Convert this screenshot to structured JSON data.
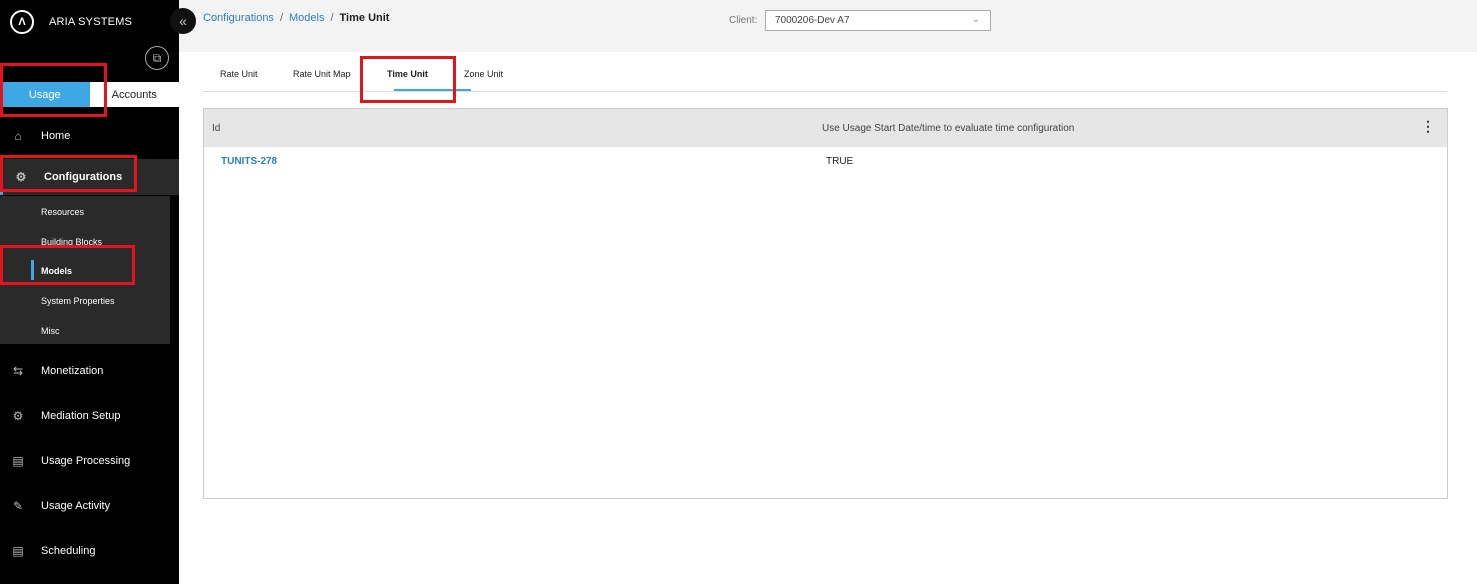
{
  "sidebar": {
    "brand_logo": "Λ",
    "brand_name": "ARIA SYSTEMS",
    "collapse_icon": "«",
    "popout_icon": "⧉",
    "module_tabs": [
      {
        "label": "Usage",
        "active": true
      },
      {
        "label": "Accounts",
        "active": false
      }
    ],
    "items": [
      {
        "label": "Home",
        "icon": "⌂"
      },
      {
        "label": "Configurations",
        "icon": "⚙"
      },
      {
        "label": "Monetization",
        "icon": "⇆"
      },
      {
        "label": "Mediation Setup",
        "icon": "⚙"
      },
      {
        "label": "Usage Processing",
        "icon": "▤"
      },
      {
        "label": "Usage Activity",
        "icon": "✎"
      },
      {
        "label": "Scheduling",
        "icon": "▤"
      }
    ],
    "sub_items": [
      "Resources",
      "Building Blocks",
      "Models",
      "System Properties",
      "Misc"
    ]
  },
  "breadcrumb": {
    "items": [
      "Configurations",
      "Models"
    ],
    "separator": "/",
    "current": "Time Unit"
  },
  "client": {
    "label": "Client:",
    "value": "7000206-Dev A7",
    "chevron": "⌄"
  },
  "tabs": [
    "Rate Unit",
    "Rate Unit Map",
    "Time Unit",
    "Zone Unit"
  ],
  "active_tab": "Time Unit",
  "grid": {
    "columns": [
      "Id",
      "Use Usage Start Date/time to evaluate time configuration"
    ],
    "menu_icon": "⋮",
    "rows": [
      {
        "id": "TUNITS-278",
        "use_start": "TRUE"
      }
    ]
  },
  "colors": {
    "accent": "#3ea8e5",
    "highlight": "#e3141b",
    "link": "#2a7fc4"
  }
}
